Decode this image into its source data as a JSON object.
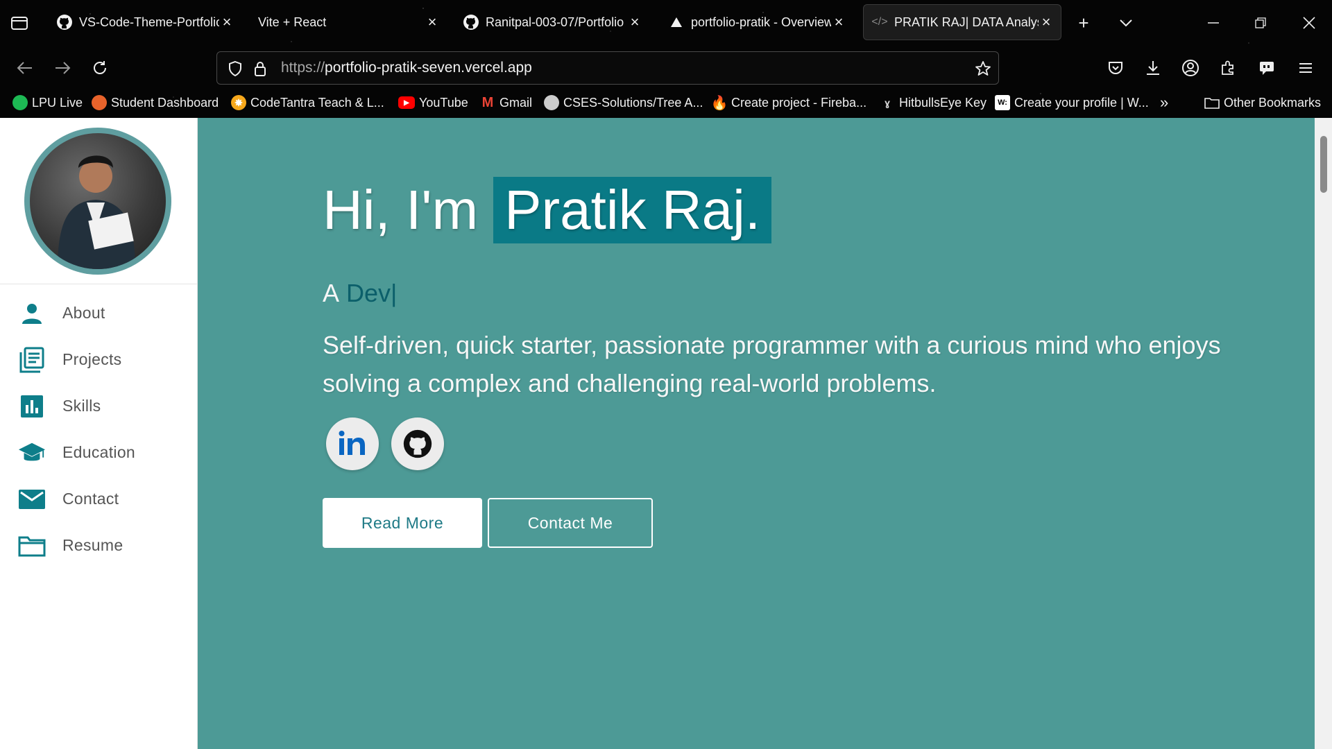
{
  "browser": {
    "tabs": [
      {
        "title": "VS-Code-Theme-Portfolio",
        "icon": "github-icon",
        "active": false
      },
      {
        "title": "Vite + React",
        "icon": "none",
        "active": false
      },
      {
        "title": "Ranitpal-003-07/Portfolio",
        "icon": "github-icon",
        "active": false
      },
      {
        "title": "portfolio-pratik - Overview",
        "icon": "vercel-triangle-icon",
        "active": false
      },
      {
        "title": "PRATIK RAJ| DATA Analyst",
        "icon": "code-icon",
        "active": true
      }
    ],
    "url": {
      "protocol": "https://",
      "host": "portfolio-pratik-seven.vercel.app"
    },
    "bookmarks": [
      {
        "label": "LPU Live",
        "color": "#1db954"
      },
      {
        "label": "Student Dashboard",
        "color": "#e8632b"
      },
      {
        "label": "CodeTantra Teach & L...",
        "color": "#f7a81b"
      },
      {
        "label": "YouTube",
        "color": "#ff0000"
      },
      {
        "label": "Gmail",
        "color": "#ea4335"
      },
      {
        "label": "CSES-Solutions/Tree A...",
        "color": "#cccccc"
      },
      {
        "label": "Create project - Fireba...",
        "color": "#ff7a00"
      },
      {
        "label": "HitbullsEye Key",
        "color": "#dddddd"
      },
      {
        "label": "Create your profile | W...",
        "color": "#ffffff"
      }
    ],
    "other_bookmarks": "Other Bookmarks"
  },
  "sidebar": {
    "items": [
      {
        "label": "About",
        "icon": "person-icon"
      },
      {
        "label": "Projects",
        "icon": "documents-icon"
      },
      {
        "label": "Skills",
        "icon": "bar-chart-icon"
      },
      {
        "label": "Education",
        "icon": "graduation-cap-icon"
      },
      {
        "label": "Contact",
        "icon": "mail-icon"
      },
      {
        "label": "Resume",
        "icon": "folder-icon"
      }
    ]
  },
  "hero": {
    "greeting": "Hi, I'm",
    "name": "Pratik Raj.",
    "typed_prefix": "A",
    "typed_word": "Dev",
    "bio": "Self-driven, quick starter, passionate programmer with a curious mind who enjoys solving a complex and challenging real-world problems.",
    "socials": [
      {
        "name": "linkedin-icon"
      },
      {
        "name": "github-icon"
      }
    ],
    "primary_button": "Read More",
    "secondary_button": "Contact Me"
  },
  "colors": {
    "hero_bg": "#4d9a96",
    "accent": "#0a7a86",
    "sidebar_icon": "#0e7e8a",
    "sidebar_text": "#555555"
  }
}
